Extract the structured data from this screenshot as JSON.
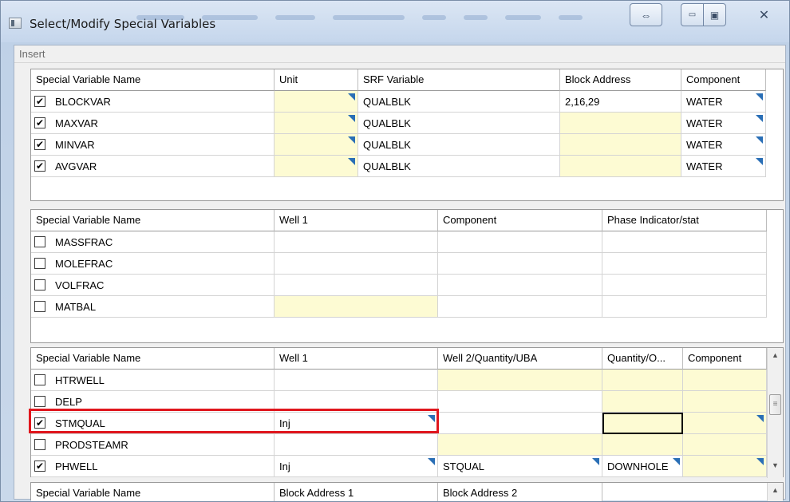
{
  "window": {
    "title": "Select/Modify Special Variables",
    "swap_glyph": "⇔",
    "min_glyph": "▭",
    "max_glyph": "▣",
    "close_glyph": "✕"
  },
  "menu": {
    "insert": "Insert"
  },
  "grid1": {
    "headers": [
      "Special Variable Name",
      "Unit",
      "SRF Variable",
      "Block Address",
      "Component"
    ],
    "rows": [
      {
        "checked": true,
        "name": "BLOCKVAR",
        "unit": "",
        "srf": "QUALBLK",
        "block": "2,16,29",
        "component": "WATER"
      },
      {
        "checked": true,
        "name": "MAXVAR",
        "unit": "",
        "srf": "QUALBLK",
        "block": "",
        "component": "WATER"
      },
      {
        "checked": true,
        "name": "MINVAR",
        "unit": "",
        "srf": "QUALBLK",
        "block": "",
        "component": "WATER"
      },
      {
        "checked": true,
        "name": "AVGVAR",
        "unit": "",
        "srf": "QUALBLK",
        "block": "",
        "component": "WATER"
      }
    ]
  },
  "grid2": {
    "headers": [
      "Special Variable Name",
      "Well 1",
      "Component",
      "Phase Indicator/stat"
    ],
    "rows": [
      {
        "checked": false,
        "name": "MASSFRAC"
      },
      {
        "checked": false,
        "name": "MOLEFRAC"
      },
      {
        "checked": false,
        "name": "VOLFRAC"
      },
      {
        "checked": false,
        "name": "MATBAL"
      }
    ]
  },
  "grid3": {
    "headers": [
      "Special Variable Name",
      "Well 1",
      "Well 2/Quantity/UBA",
      "Quantity/O...",
      "Component"
    ],
    "rows": [
      {
        "checked": false,
        "name": "HTRWELL",
        "well1": "",
        "well2": "",
        "qty": "",
        "component": ""
      },
      {
        "checked": false,
        "name": "DELP",
        "well1": "",
        "well2": "",
        "qty": "",
        "component": ""
      },
      {
        "checked": true,
        "name": "STMQUAL",
        "well1": "Inj",
        "well2": "",
        "qty": "",
        "component": ""
      },
      {
        "checked": false,
        "name": "PRODSTEAMR",
        "well1": "",
        "well2": "",
        "qty": "",
        "component": ""
      },
      {
        "checked": true,
        "name": "PHWELL",
        "well1": "Inj",
        "well2": "STQUAL",
        "qty": "DOWNHOLE",
        "component": ""
      }
    ]
  },
  "grid4": {
    "headers": [
      "Special Variable Name",
      "Block Address 1",
      "Block Address 2"
    ]
  },
  "checkmark": "✔",
  "scroll": {
    "up": "▲",
    "down": "▼",
    "grip": "≡"
  }
}
